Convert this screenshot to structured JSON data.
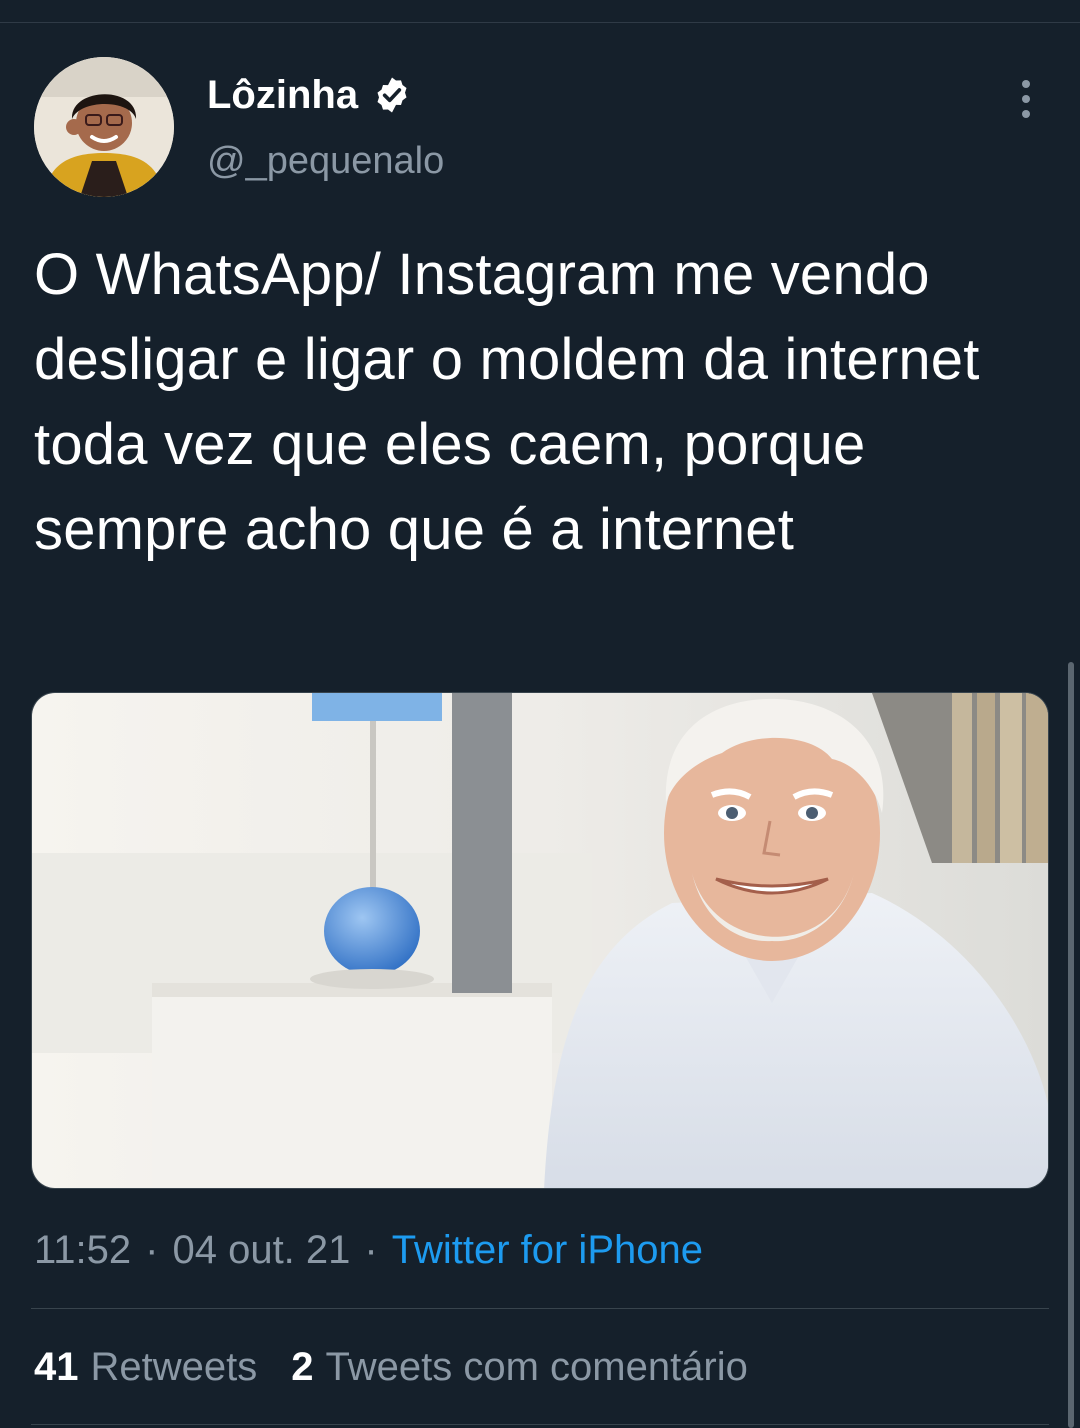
{
  "author": {
    "display_name": "Lôzinha",
    "handle": "@_pequenalo",
    "verified": true,
    "avatar": "profile-photo"
  },
  "tweet": {
    "text": "O WhatsApp/ Instagram me vendo desligar e ligar o moldem da internet toda vez que eles caem, porque sempre acho que é a internet",
    "media": "photo-smiling-older-man"
  },
  "meta": {
    "time": "11:52",
    "separator": "·",
    "date": "04 out. 21",
    "source": "Twitter for iPhone"
  },
  "stats": {
    "retweets_count": "2",
    "retweets_label": "Tweets com comentário",
    "likes_count": "41",
    "likes_label": "Retweets"
  },
  "icons": {
    "verified": "verified-badge-icon",
    "more": "more-options-icon"
  },
  "colors": {
    "background": "#15202b",
    "link": "#1d9bf0",
    "secondary_text": "#8b98a5"
  }
}
